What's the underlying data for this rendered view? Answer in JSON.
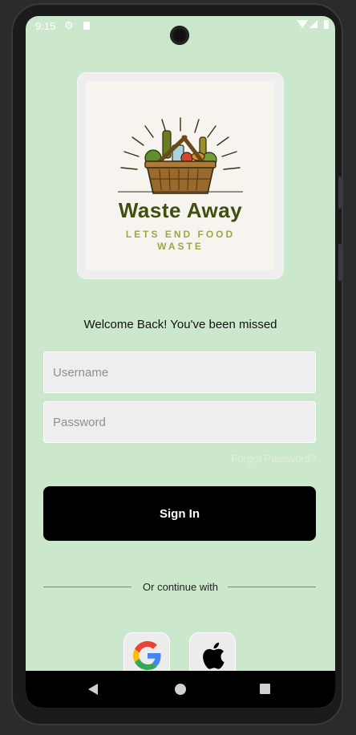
{
  "status_bar": {
    "time": "9:15",
    "icons": [
      "gear-icon",
      "sd-card-icon",
      "wifi-icon",
      "signal-icon",
      "battery-icon"
    ]
  },
  "logo": {
    "title": "Waste Away",
    "subtitle": "LETS END FOOD WASTE",
    "icon": "food-basket-illustration"
  },
  "welcome_text": "Welcome Back! You've been missed",
  "form": {
    "username_placeholder": "Username",
    "password_placeholder": "Password",
    "forgot_password": "Forgot Password?",
    "sign_in_label": "Sign In"
  },
  "divider_text": "Or continue with",
  "social": {
    "google_icon": "google-icon",
    "apple_icon": "apple-icon"
  },
  "nav_bar": {
    "icons": [
      "back-icon",
      "home-icon",
      "recents-icon"
    ]
  },
  "colors": {
    "background": "#cce8cc",
    "button": "#000000",
    "field": "#eeeeee",
    "logo_title": "#3f4f10",
    "logo_subtitle": "#9aa74a"
  }
}
